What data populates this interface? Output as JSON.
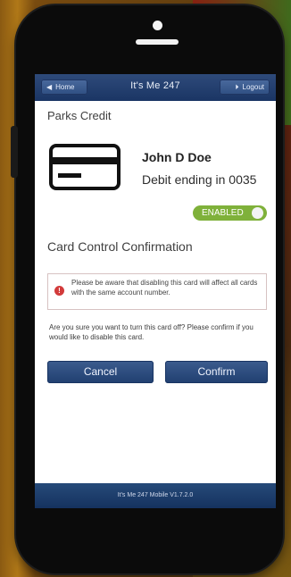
{
  "app": {
    "title": "It's Me 247",
    "home_label": "Home",
    "logout_label": "Logout"
  },
  "card": {
    "section_title": "Parks Credit",
    "holder_name": "John D Doe",
    "account_label": "Debit ending in 0035",
    "status_label": "ENABLED"
  },
  "confirmation": {
    "title": "Card Control Confirmation",
    "warning_text": "Please be aware that disabling this card will affect all cards with the same account number.",
    "question_text": "Are you sure you want to turn this card off? Please confirm if you would like to disable this card.",
    "cancel_label": "Cancel",
    "confirm_label": "Confirm"
  },
  "footer": {
    "version_text": "It's Me 247 Mobile V1.7.2.0"
  },
  "colors": {
    "topbar": "#1a3564",
    "button": "#203f70",
    "toggle_on": "#7fb13a",
    "alert_icon": "#d23b3b"
  },
  "icons": {
    "home": "home-icon",
    "logout": "logout-icon",
    "card": "credit-card-icon",
    "alert": "alert-icon"
  }
}
